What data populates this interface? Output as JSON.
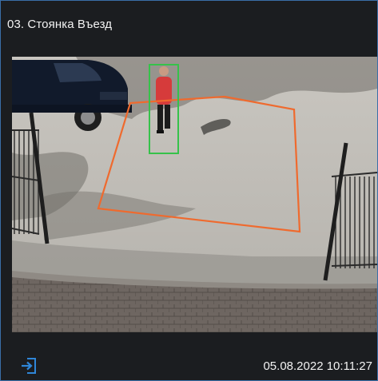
{
  "camera": {
    "title": "03. Стоянка Въезд",
    "timestamp": "05.08.2022 10:11:27"
  },
  "icons": {
    "exit": "exit-to-door-icon"
  },
  "colors": {
    "border": "#3a6ea8",
    "zone": "#ef6a2e",
    "detection": "#36c24a",
    "icon": "#2f86d8",
    "background": "#1b1d20"
  }
}
